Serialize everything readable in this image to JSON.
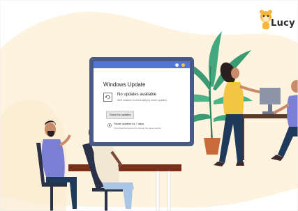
{
  "brand": {
    "name": "Lucy"
  },
  "windows_update": {
    "title": "Windows Update",
    "status": "No updates available",
    "detail": "We'll continue to check daily for newer updates.",
    "check_button": "Check for updates",
    "pause_label": "Pause updates for 7 days",
    "pause_sub": "Visit Advanced options to change the pause period"
  },
  "colors": {
    "background_blob": "#fdf3df",
    "monitor_frame": "#4a5a86",
    "title_strip": "#5276d4",
    "accent_yellow": "#f5c24b",
    "table_brown": "#7a2f1b",
    "shirt_purple": "#7b7fd6",
    "shirt_yellow": "#f4c542",
    "plant_green": "#3a9a72"
  },
  "icons": [
    "mascot-icon",
    "refresh-icon",
    "pause-icon",
    "plant-icon"
  ]
}
